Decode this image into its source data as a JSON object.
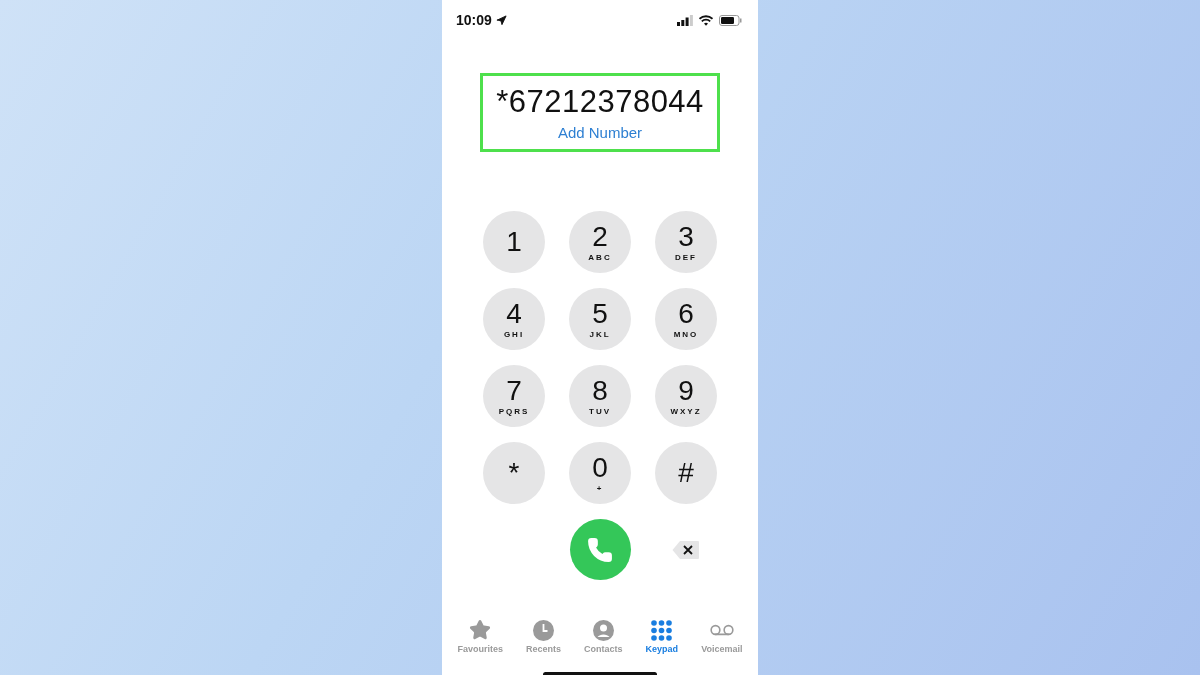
{
  "status_bar": {
    "time": "10:09"
  },
  "dialed": {
    "number": "*67212378044",
    "action": "Add Number",
    "highlighted": true
  },
  "keys": [
    {
      "digit": "1"
    },
    {
      "digit": "2",
      "letters": "ABC"
    },
    {
      "digit": "3",
      "letters": "DEF"
    },
    {
      "digit": "4",
      "letters": "GHI"
    },
    {
      "digit": "5",
      "letters": "JKL"
    },
    {
      "digit": "6",
      "letters": "MNO"
    },
    {
      "digit": "7",
      "letters": "PQRS"
    },
    {
      "digit": "8",
      "letters": "TUV"
    },
    {
      "digit": "9",
      "letters": "WXYZ"
    },
    {
      "digit": "*"
    },
    {
      "digit": "0",
      "letters": "+"
    },
    {
      "digit": "#"
    }
  ],
  "tabs": [
    {
      "kind": "star",
      "label": "Favourites",
      "selected": false
    },
    {
      "kind": "clock",
      "label": "Recents",
      "selected": false
    },
    {
      "kind": "contact",
      "label": "Contacts",
      "selected": false
    },
    {
      "kind": "keypad",
      "label": "Keypad",
      "selected": true
    },
    {
      "kind": "voicemail",
      "label": "Voicemail",
      "selected": false
    }
  ]
}
